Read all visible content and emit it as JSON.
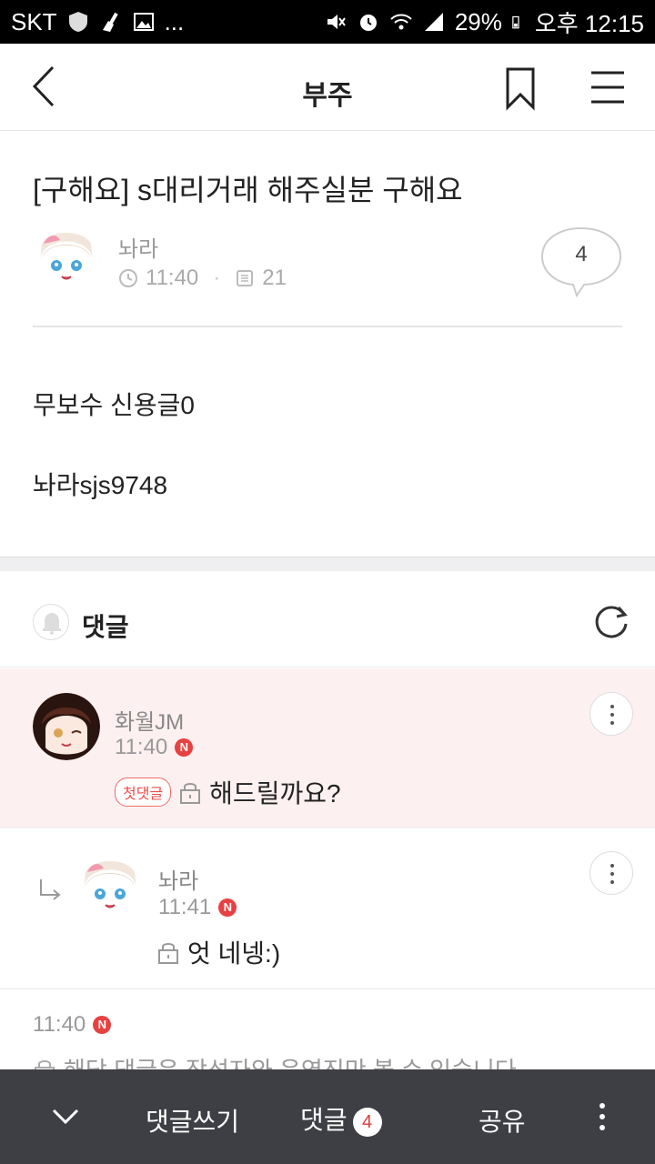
{
  "status_bar": {
    "carrier": "SKT",
    "dots": "...",
    "battery": "29%",
    "time": "오후 12:15"
  },
  "header": {
    "title": "부주"
  },
  "post": {
    "title": "[구해요] s대리거래 해주실분 구해요",
    "author": "놔라",
    "time": "11:40",
    "views": "21",
    "comment_count": "4",
    "body_lines": [
      "무보수 신용글0",
      "놔라sjs9748"
    ]
  },
  "comments_section": {
    "title": "댓글"
  },
  "comments": [
    {
      "author": "화월JM",
      "time": "11:40",
      "badge": "첫댓글",
      "text": "해드릴까요?"
    },
    {
      "author": "놔라",
      "time": "11:41",
      "text": "엇 네넹:)"
    },
    {
      "time": "11:40",
      "text": "해당 댓글은 작성자와 운영진만 볼 수 있습니다"
    }
  ],
  "bottom_bar": {
    "write_label": "댓글쓰기",
    "comments_label": "댓글",
    "comments_count": "4",
    "share_label": "공유"
  },
  "badge_letter": "N",
  "colors": {
    "accent_red": "#e84141",
    "highlight_bg": "#fdf0f1",
    "bottom_bar_bg": "#3d3f44"
  }
}
